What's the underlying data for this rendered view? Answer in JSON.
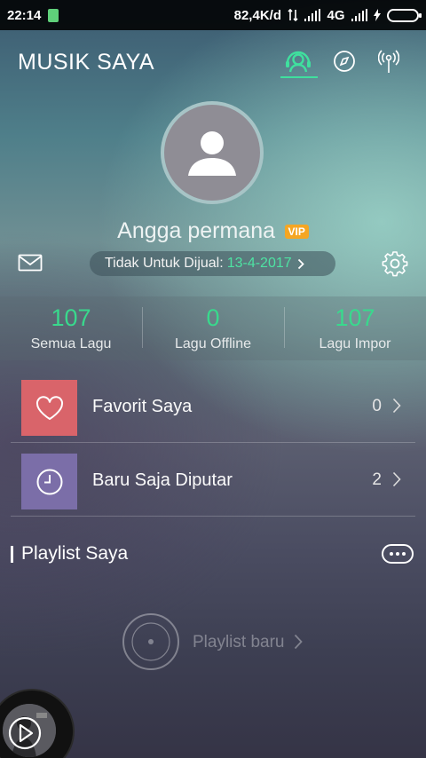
{
  "status_bar": {
    "time": "22:14",
    "speed": "82,4K/d",
    "network": "4G"
  },
  "header": {
    "title": "MUSIK SAYA",
    "tabs": [
      {
        "icon": "headphones-user-icon",
        "active": true
      },
      {
        "icon": "compass-icon",
        "active": false
      },
      {
        "icon": "radio-tower-icon",
        "active": false
      }
    ],
    "accent": "#3fe09e"
  },
  "profile": {
    "name": "Angga permana",
    "badge": "VIP",
    "subscription_label": "Tidak Untuk Dijual:",
    "subscription_date": "13-4-2017"
  },
  "stats": [
    {
      "value": "107",
      "label": "Semua Lagu"
    },
    {
      "value": "0",
      "label": "Lagu Offline"
    },
    {
      "value": "107",
      "label": "Lagu Impor"
    }
  ],
  "menu": [
    {
      "label": "Favorit Saya",
      "count": "0",
      "icon": "heart-icon",
      "color": "#d9646a"
    },
    {
      "label": "Baru Saja Diputar",
      "count": "2",
      "icon": "clock-icon",
      "color": "#7b6ea8"
    }
  ],
  "playlist": {
    "title": "Playlist Saya",
    "new_label": "Playlist baru"
  },
  "colors": {
    "accent_green": "#39d98d",
    "vip_orange": "#f5a623"
  }
}
